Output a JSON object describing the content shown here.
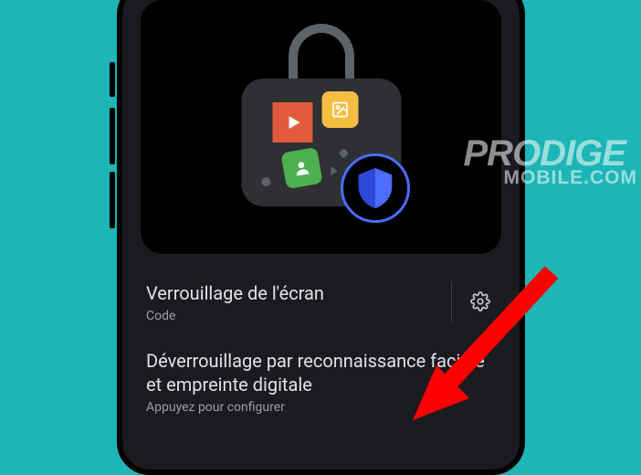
{
  "hero": {
    "shield_icon": "shield-icon"
  },
  "settings": {
    "screen_lock": {
      "title": "Verrouillage de l'écran",
      "subtitle": "Code",
      "gear_icon": "gear-icon"
    },
    "biometric": {
      "title": "Déverrouillage par reconnaissance faciale et empreinte digitale",
      "subtitle": "Appuyez pour configurer"
    }
  },
  "watermark": {
    "line1": "PRODIGE",
    "line2": "MOBILE.COM"
  }
}
